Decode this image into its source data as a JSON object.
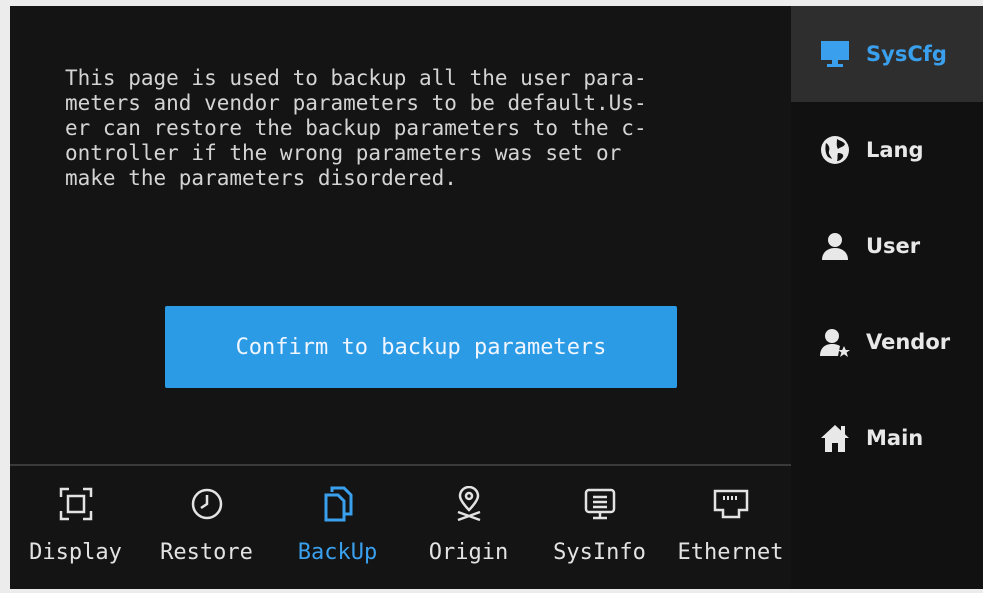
{
  "page": {
    "description": "This page is used to backup all the user para-\nmeters and vendor parameters to be default.Us-\ner can restore the backup parameters to the c-\nontroller if the wrong parameters was set or\nmake the parameters disordered.",
    "confirm_label": "Confirm to backup parameters"
  },
  "tabs": [
    {
      "label": "Display",
      "icon": "display-icon"
    },
    {
      "label": "Restore",
      "icon": "clock-icon"
    },
    {
      "label": "BackUp",
      "icon": "copy-icon",
      "active": true
    },
    {
      "label": "Origin",
      "icon": "location-pin-icon"
    },
    {
      "label": "SysInfo",
      "icon": "info-list-icon"
    },
    {
      "label": "Ethernet",
      "icon": "ethernet-port-icon"
    }
  ],
  "sidebar": [
    {
      "label": "SysCfg",
      "icon": "monitor-icon",
      "active": true
    },
    {
      "label": "Lang",
      "icon": "globe-icon"
    },
    {
      "label": "User",
      "icon": "user-icon"
    },
    {
      "label": "Vendor",
      "icon": "vendor-icon"
    },
    {
      "label": "Main",
      "icon": "home-icon"
    }
  ],
  "colors": {
    "accent": "#3aa0ee",
    "button": "#2b9be6",
    "background": "#141414"
  }
}
